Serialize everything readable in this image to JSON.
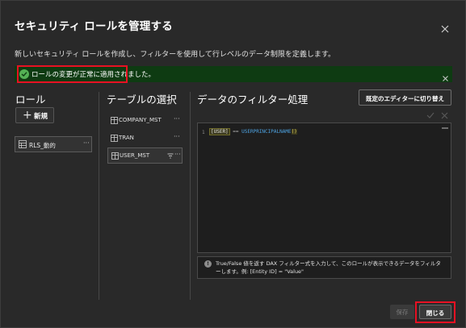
{
  "dialog": {
    "title": "セキュリティ ロールを管理する",
    "description": "新しいセキュリティ ロールを作成し、フィルターを使用して行レベルのデータ制限を定義します。",
    "close_icon": "close-icon"
  },
  "banner": {
    "message": "ロールの変更が正常に適用されました。",
    "icon": "check-circle-icon",
    "color": "#0e3b12"
  },
  "roles": {
    "title": "ロール",
    "new_label": "新規",
    "items": [
      {
        "label": "RLS_動的",
        "more": "···"
      }
    ]
  },
  "tables": {
    "title": "テーブルの選択",
    "items": [
      {
        "label": "COMPANY_MST",
        "more": "···"
      },
      {
        "label": "TRAN",
        "more": "···"
      },
      {
        "label": "USER_MST",
        "more": "···"
      }
    ]
  },
  "filter": {
    "title": "データのフィルター処理",
    "switch_label": "既定のエディターに切り替え",
    "editor": {
      "line_number": "1",
      "entity": "[USER]",
      "operator": " == ",
      "function": "USERPRINCIPALNAME",
      "parens": "()"
    },
    "info": "True/False 値を返す DAX フィルター式を入力して、このロールが表示できるデータをフィルターします。例: [Entity ID] = \"Value\""
  },
  "footer": {
    "save_label": "保存",
    "close_label": "閉じる"
  },
  "colors": {
    "highlight": "#e81123",
    "accent_check": "#54b054"
  }
}
